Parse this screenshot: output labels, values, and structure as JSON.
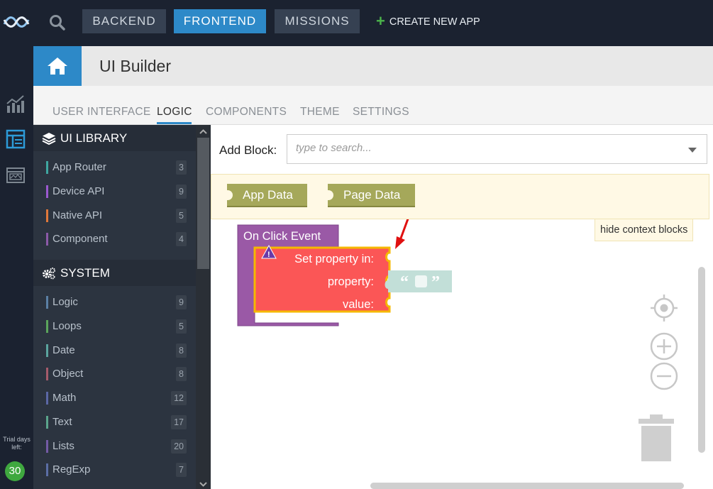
{
  "topbar": {
    "tabs": [
      {
        "label": "BACKEND",
        "active": false
      },
      {
        "label": "FRONTEND",
        "active": true
      },
      {
        "label": "MISSIONS",
        "active": false
      }
    ],
    "create_app": "CREATE NEW APP"
  },
  "rail": {
    "trial_label": "Trial days left:",
    "trial_days": "30"
  },
  "header": {
    "title": "UI Builder"
  },
  "subtabs": [
    {
      "label": "USER INTERFACE",
      "active": false
    },
    {
      "label": "LOGIC",
      "active": true
    },
    {
      "label": "COMPONENTS",
      "active": false
    },
    {
      "label": "THEME",
      "active": false
    },
    {
      "label": "SETTINGS",
      "active": false
    }
  ],
  "library": {
    "sections": [
      {
        "title": "UI LIBRARY",
        "icon": "layers-icon",
        "items": [
          {
            "label": "App Router",
            "count": "3",
            "color": "#3fa7a1"
          },
          {
            "label": "Device API",
            "count": "9",
            "color": "#9b59d0"
          },
          {
            "label": "Native API",
            "count": "5",
            "color": "#e0783a"
          },
          {
            "label": "Component",
            "count": "4",
            "color": "#8c5aa8"
          }
        ]
      },
      {
        "title": "SYSTEM",
        "icon": "gears-icon",
        "items": [
          {
            "label": "Logic",
            "count": "9",
            "color": "#5b80a5"
          },
          {
            "label": "Loops",
            "count": "5",
            "color": "#5ba55b"
          },
          {
            "label": "Date",
            "count": "8",
            "color": "#5ba59f"
          },
          {
            "label": "Object",
            "count": "8",
            "color": "#a55b6b"
          },
          {
            "label": "Math",
            "count": "12",
            "color": "#5b67a5"
          },
          {
            "label": "Text",
            "count": "17",
            "color": "#5ba58c"
          },
          {
            "label": "Lists",
            "count": "20",
            "color": "#745ba5"
          },
          {
            "label": "RegExp",
            "count": "7",
            "color": "#5b6ea5"
          }
        ]
      }
    ]
  },
  "workspace": {
    "add_block_label": "Add Block:",
    "search_placeholder": "type to search...",
    "context_blocks": [
      "App Data",
      "Page Data"
    ],
    "hide_context": "hide context blocks",
    "event_block": "On Click Event",
    "set_block": {
      "title": "Set property in:",
      "property_label": "property:",
      "value_label": "value:",
      "string_open": "“",
      "string_close": "”"
    },
    "colors": {
      "event": "#9a59a6",
      "set_property": "#fb5656",
      "set_property_border": "#f5b800",
      "string_block": "#c2dfd8",
      "context_block": "#a5a85a",
      "accent": "#2d89c8"
    }
  }
}
